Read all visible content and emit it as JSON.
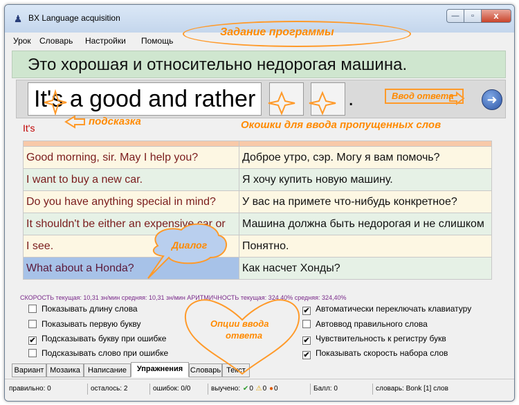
{
  "window": {
    "title": "BX Language acquisition",
    "controls": {
      "minimize": "—",
      "maximize": "▫",
      "close": "x"
    }
  },
  "menu": {
    "items": [
      "Урок",
      "Словарь",
      "Настройки",
      "Помощь"
    ]
  },
  "sentence": "Это хорошая и относительно недорогая машина.",
  "answer": {
    "typed": "It's a good and rather",
    "end_punct": "."
  },
  "hint": "It's",
  "dialog": {
    "rows": [
      {
        "en": "Good morning, sir. May I help you?",
        "ru": "Доброе утро, сэр. Могу я вам помочь?"
      },
      {
        "en": "I want to buy a new car.",
        "ru": "Я хочу купить новую машину."
      },
      {
        "en": "Do you have anything special in mind?",
        "ru": "У вас на примете что-нибудь конкретное?"
      },
      {
        "en": "It shouldn't be either an expensive car or",
        "ru": "Машина должна быть недорогая и не слишком"
      },
      {
        "en": "I see.",
        "ru": "Понятно."
      },
      {
        "en": "What about a Honda?",
        "ru": "Как насчет Хонды?"
      }
    ]
  },
  "speed": "СКОРОСТЬ текущая: 10,31 зн/мин  средняя: 10,31 зн/мин   АРИТМИЧНОСТЬ текущая: 324,40% средняя: 324,40%",
  "options": {
    "left": [
      {
        "label": "Показывать длину слова",
        "checked": false
      },
      {
        "label": "Показывать первую букву",
        "checked": false
      },
      {
        "label": "Подсказывать букву при ошибке",
        "checked": true
      },
      {
        "label": "Подсказывать слово при ошибке",
        "checked": false
      }
    ],
    "right": [
      {
        "label": "Автоматически переключать клавиатуру",
        "checked": true
      },
      {
        "label": "Автоввод правильного слова",
        "checked": false
      },
      {
        "label": "Чувствительность к регистру букв",
        "checked": true
      },
      {
        "label": "Показывать скорость набора слов",
        "checked": true
      }
    ]
  },
  "tabs": [
    {
      "label": "Вариант",
      "active": false
    },
    {
      "label": "Мозаика",
      "active": false
    },
    {
      "label": "Написание",
      "active": false
    },
    {
      "label": "Упражнения",
      "active": true
    },
    {
      "label": "Словарь",
      "active": false
    },
    {
      "label": "Текст",
      "active": false
    }
  ],
  "status": {
    "correct": "правильно: 0",
    "remaining": "осталось: 2",
    "errors": "ошибок: 0/0",
    "learned_label": "выучено:",
    "learned_a": "0",
    "learned_b": "0",
    "learned_c": "0",
    "score": "Балл: 0",
    "dictionary": "словарь: Bonk [1] слов"
  },
  "annotations": {
    "task": "Задание программы",
    "answer_input": "Ввод ответа",
    "hint": "подсказка",
    "blanks": "Окошки для ввода пропущенных слов",
    "dialog": "Диалог",
    "options_line1": "Опции ввода",
    "options_line2": "ответа"
  },
  "colors": {
    "accent_orange": "#ff8a00",
    "hint_red": "#c00000",
    "sentence_bg": "#cfe6cf"
  }
}
